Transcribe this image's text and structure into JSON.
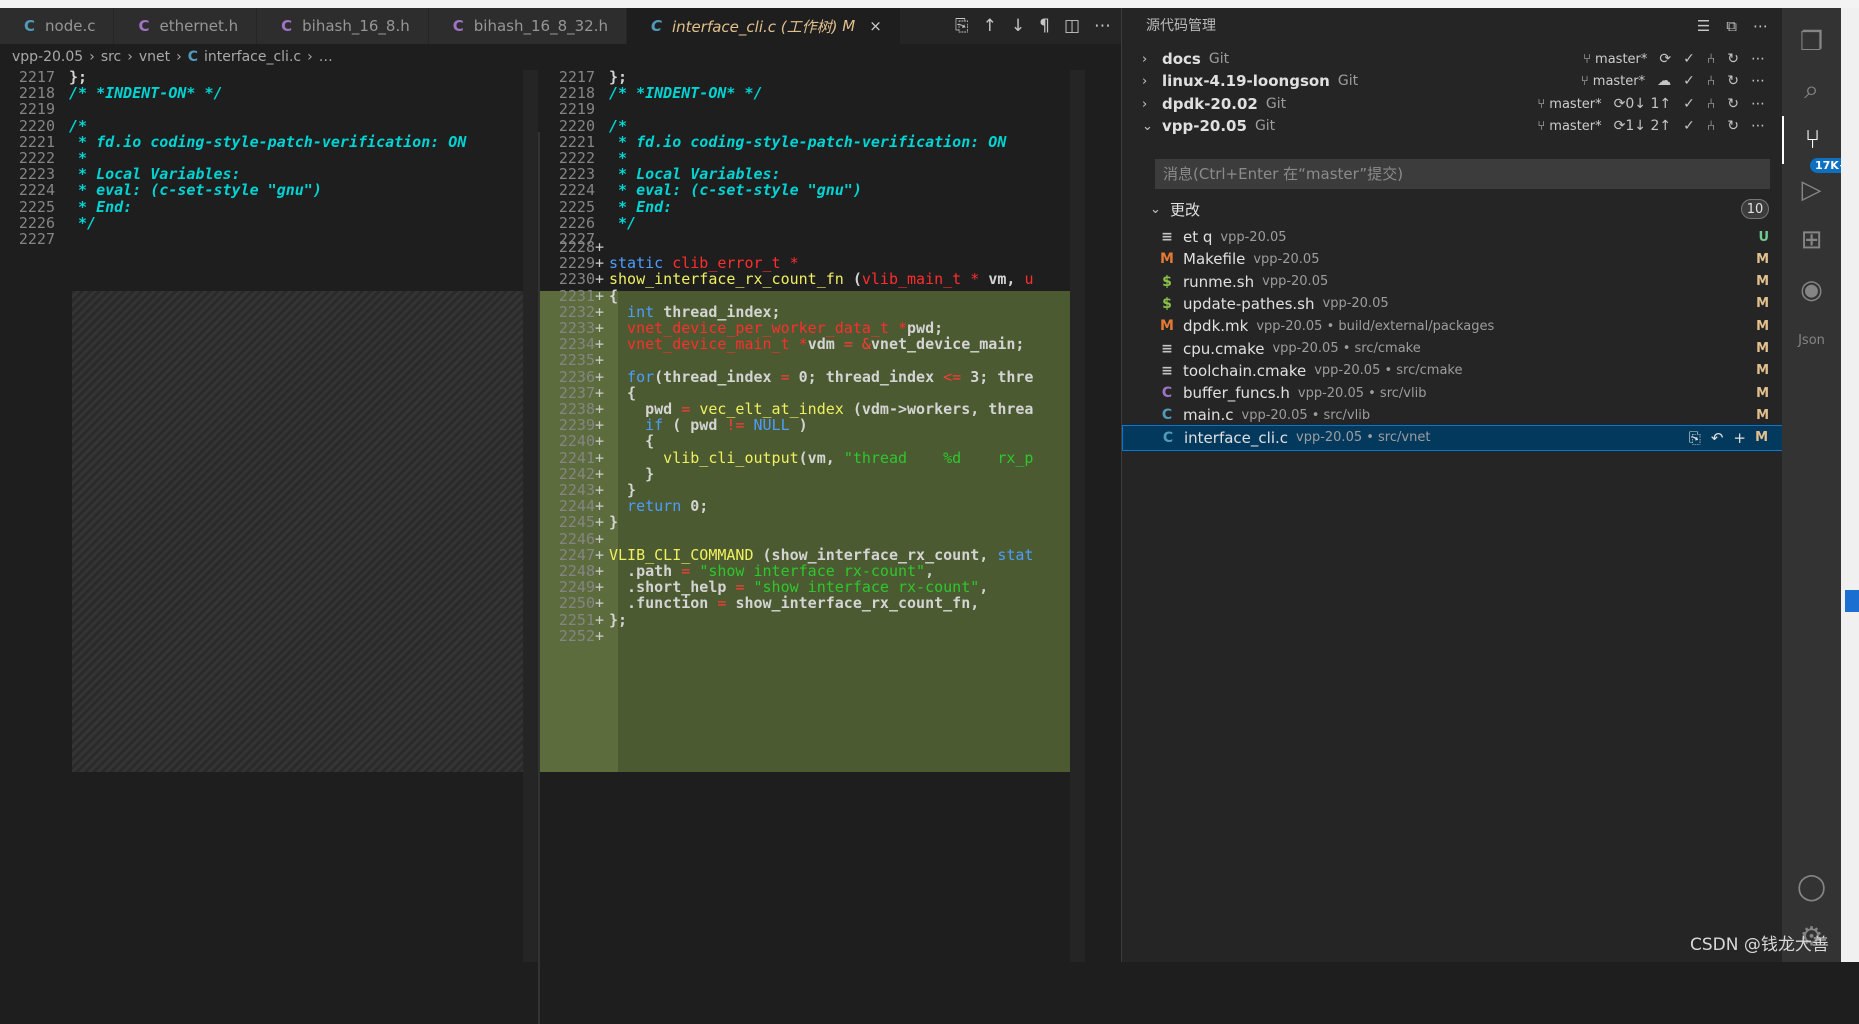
{
  "tabs": [
    {
      "icon": "C",
      "label": "node.c"
    },
    {
      "icon": "C",
      "label": "ethernet.h"
    },
    {
      "icon": "C",
      "label": "bihash_16_8.h"
    },
    {
      "icon": "C",
      "label": "bihash_16_8_32.h"
    },
    {
      "icon": "C",
      "label": "interface_cli.c (工作树)",
      "status": "M",
      "close": "×"
    }
  ],
  "breadcrumb": [
    "vpp-20.05",
    "›",
    "src",
    "›",
    "vnet",
    "›",
    "C",
    "interface_cli.c",
    "›",
    "…"
  ],
  "diff": {
    "left": [
      {
        "n": "2217",
        "t": "};",
        "k": "code"
      },
      {
        "n": "2218",
        "t": "/* *INDENT-ON* */",
        "k": "cm"
      },
      {
        "n": "2219",
        "t": "",
        "k": "code"
      },
      {
        "n": "2220",
        "t": "/*",
        "k": "cm"
      },
      {
        "n": "2221",
        "t": " * fd.io coding-style-patch-verification: ON",
        "k": "cm"
      },
      {
        "n": "2222",
        "t": " *",
        "k": "cm"
      },
      {
        "n": "2223",
        "t": " * Local Variables:",
        "k": "cm"
      },
      {
        "n": "2224",
        "t": " * eval: (c-set-style \"gnu\")",
        "k": "cm"
      },
      {
        "n": "2225",
        "t": " * End:",
        "k": "cm"
      },
      {
        "n": "2226",
        "t": " */",
        "k": "cm"
      },
      {
        "n": "2227",
        "t": "",
        "k": "code"
      }
    ],
    "right_context": [
      {
        "n": "2217",
        "t": "};",
        "k": "code"
      },
      {
        "n": "2218",
        "t": "/* *INDENT-ON* */",
        "k": "cm"
      },
      {
        "n": "2219",
        "t": "",
        "k": "code"
      },
      {
        "n": "2220",
        "t": "/*",
        "k": "cm"
      },
      {
        "n": "2221",
        "t": " * fd.io coding-style-patch-verification: ON",
        "k": "cm"
      },
      {
        "n": "2222",
        "t": " *",
        "k": "cm"
      },
      {
        "n": "2223",
        "t": " * Local Variables:",
        "k": "cm"
      },
      {
        "n": "2224",
        "t": " * eval: (c-set-style \"gnu\")",
        "k": "cm"
      },
      {
        "n": "2225",
        "t": " * End:",
        "k": "cm"
      },
      {
        "n": "2226",
        "t": " */",
        "k": "cm"
      },
      {
        "n": "2227",
        "t": "",
        "k": "code"
      }
    ],
    "added": [
      {
        "n": "2228",
        "segs": []
      },
      {
        "n": "2229",
        "segs": [
          [
            "kw",
            "static "
          ],
          [
            "ty",
            "clib_error_t *"
          ]
        ]
      },
      {
        "n": "2230",
        "segs": [
          [
            "fn",
            "show_interface_rx_count_fn "
          ],
          [
            "code",
            "("
          ],
          [
            "ty",
            "vlib_main_t * "
          ],
          [
            "code",
            "vm, "
          ],
          [
            "ty",
            "u"
          ]
        ]
      },
      {
        "n": "2231",
        "segs": [
          [
            "code",
            "{"
          ]
        ]
      },
      {
        "n": "2232",
        "segs": [
          [
            "kw",
            "  int "
          ],
          [
            "code",
            "thread_index;"
          ]
        ]
      },
      {
        "n": "2233",
        "segs": [
          [
            "ty",
            "  vnet_device_per_worker_data_t *"
          ],
          [
            "code",
            "pwd;"
          ]
        ]
      },
      {
        "n": "2234",
        "segs": [
          [
            "ty",
            "  vnet_device_main_t *"
          ],
          [
            "code",
            "vdm "
          ],
          [
            "op",
            "= &"
          ],
          [
            "code",
            "vnet_device_main;"
          ]
        ]
      },
      {
        "n": "2235",
        "segs": []
      },
      {
        "n": "2236",
        "segs": [
          [
            "kw",
            "  for"
          ],
          [
            "code",
            "(thread_index "
          ],
          [
            "op",
            "= "
          ],
          [
            "code",
            "0; thread_index "
          ],
          [
            "op",
            "<= "
          ],
          [
            "code",
            "3; thre"
          ]
        ]
      },
      {
        "n": "2237",
        "segs": [
          [
            "code",
            "  {"
          ]
        ]
      },
      {
        "n": "2238",
        "segs": [
          [
            "code",
            "    pwd "
          ],
          [
            "op",
            "= "
          ],
          [
            "fn",
            "vec_elt_at_index "
          ],
          [
            "code",
            "(vdm->workers, threa"
          ]
        ]
      },
      {
        "n": "2239",
        "segs": [
          [
            "kw",
            "    if "
          ],
          [
            "code",
            "( pwd "
          ],
          [
            "op",
            "!= "
          ],
          [
            "kw",
            "NULL "
          ],
          [
            "code",
            ")"
          ]
        ]
      },
      {
        "n": "2240",
        "segs": [
          [
            "code",
            "    {"
          ]
        ]
      },
      {
        "n": "2241",
        "segs": [
          [
            "fn",
            "      vlib_cli_output"
          ],
          [
            "code",
            "(vm, "
          ],
          [
            "st",
            "\"thread    %d    rx_p"
          ]
        ]
      },
      {
        "n": "2242",
        "segs": [
          [
            "code",
            "    }"
          ]
        ]
      },
      {
        "n": "2243",
        "segs": [
          [
            "code",
            "  }"
          ]
        ]
      },
      {
        "n": "2244",
        "segs": [
          [
            "kw",
            "  return "
          ],
          [
            "code",
            "0;"
          ]
        ]
      },
      {
        "n": "2245",
        "segs": [
          [
            "code",
            "}"
          ]
        ]
      },
      {
        "n": "2246",
        "segs": []
      },
      {
        "n": "2247",
        "segs": [
          [
            "fn",
            "VLIB_CLI_COMMAND "
          ],
          [
            "code",
            "(show_interface_rx_count, "
          ],
          [
            "kw",
            "stat"
          ]
        ]
      },
      {
        "n": "2248",
        "segs": [
          [
            "code",
            "  .path "
          ],
          [
            "op",
            "= "
          ],
          [
            "st",
            "\"show interface rx-count\""
          ],
          [
            "code",
            ","
          ]
        ]
      },
      {
        "n": "2249",
        "segs": [
          [
            "code",
            "  .short_help "
          ],
          [
            "op",
            "= "
          ],
          [
            "st",
            "\"show interface rx-count\""
          ],
          [
            "code",
            ","
          ]
        ]
      },
      {
        "n": "2250",
        "segs": [
          [
            "code",
            "  .function "
          ],
          [
            "op",
            "= "
          ],
          [
            "code",
            "show_interface_rx_count_fn,"
          ]
        ]
      },
      {
        "n": "2251",
        "segs": [
          [
            "code",
            "};"
          ]
        ]
      },
      {
        "n": "2252",
        "segs": []
      }
    ],
    "added_mark": "+"
  },
  "scm": {
    "title": "源代码管理",
    "repos": [
      {
        "chev": "›",
        "name": "docs",
        "git": "Git",
        "branch": "master*",
        "sync": "⟳",
        "expanded": false
      },
      {
        "chev": "›",
        "name": "linux-4.19-loongson",
        "git": "Git",
        "branch": "master*",
        "sync": "☁",
        "expanded": false
      },
      {
        "chev": "›",
        "name": "dpdk-20.02",
        "git": "Git",
        "branch": "master*",
        "sync": "⟳0↓ 1↑",
        "expanded": false
      },
      {
        "chev": "⌄",
        "name": "vpp-20.05",
        "git": "Git",
        "branch": "master*",
        "sync": "⟳1↓ 2↑",
        "expanded": true
      }
    ],
    "message_placeholder": "消息(Ctrl+Enter 在“master”提交)",
    "changes_label": "更改",
    "changes_count": "10",
    "files": [
      {
        "icon": "≡",
        "icon_color": "#c5c5c5",
        "name": "et q",
        "desc": "vpp-20.05",
        "status": "U"
      },
      {
        "icon": "M",
        "icon_color": "#e37933",
        "name": "Makefile",
        "desc": "vpp-20.05",
        "status": "M"
      },
      {
        "icon": "$",
        "icon_color": "#8dc149",
        "name": "runme.sh",
        "desc": "vpp-20.05",
        "status": "M"
      },
      {
        "icon": "$",
        "icon_color": "#8dc149",
        "name": "update-pathes.sh",
        "desc": "vpp-20.05",
        "status": "M"
      },
      {
        "icon": "M",
        "icon_color": "#e37933",
        "name": "dpdk.mk",
        "desc": "vpp-20.05 • build/external/packages",
        "status": "M"
      },
      {
        "icon": "≡",
        "icon_color": "#c5c5c5",
        "name": "cpu.cmake",
        "desc": "vpp-20.05 • src/cmake",
        "status": "M"
      },
      {
        "icon": "≡",
        "icon_color": "#c5c5c5",
        "name": "toolchain.cmake",
        "desc": "vpp-20.05 • src/cmake",
        "status": "M"
      },
      {
        "icon": "C",
        "icon_color": "#a074c4",
        "name": "buffer_funcs.h",
        "desc": "vpp-20.05 • src/vlib",
        "status": "M"
      },
      {
        "icon": "C",
        "icon_color": "#519aba",
        "name": "main.c",
        "desc": "vpp-20.05 • src/vlib",
        "status": "M"
      },
      {
        "icon": "C",
        "icon_color": "#519aba",
        "name": "interface_cli.c",
        "desc": "vpp-20.05 • src/vnet",
        "status": "M",
        "selected": true
      }
    ]
  },
  "activity": {
    "scm_badge": "17K+"
  },
  "watermark": "CSDN @钱龙大善"
}
